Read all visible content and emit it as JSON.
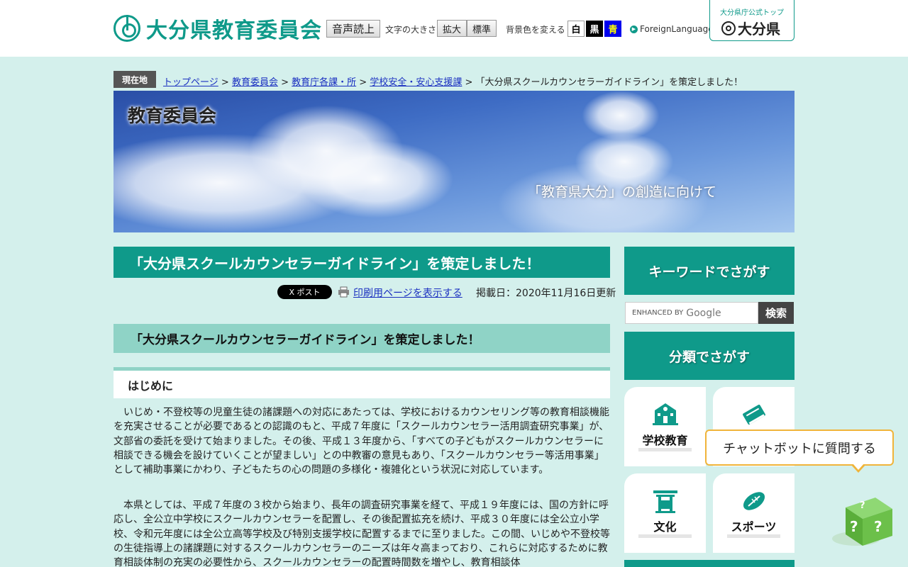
{
  "header": {
    "logo_text": "大分県教育委員会",
    "voice_button": "音声読上",
    "font_size_label": "文字の大きさ",
    "enlarge_button": "拡大",
    "standard_button": "標準",
    "bg_color_label": "背景色を変える",
    "bg_white": "白",
    "bg_black": "黒",
    "bg_blue": "青",
    "foreign_language": "ForeignLanguage",
    "pref_top_caption": "大分県庁公式トップ",
    "pref_top_name": "大分県"
  },
  "breadcrumb": {
    "tag": "現在地",
    "items": [
      {
        "label": "トップページ"
      },
      {
        "label": "教育委員会"
      },
      {
        "label": "教育庁各課・所"
      },
      {
        "label": "学校安全・安心支援課"
      }
    ],
    "current": "「大分県スクールカウンセラーガイドライン」を策定しました！",
    "separator": ">"
  },
  "banner": {
    "title": "教育委員会",
    "subtitle": "「教育県大分」の創造に向けて"
  },
  "main": {
    "page_title": "「大分県スクールカウンセラーガイドライン」を策定しました！",
    "x_post": "X ポスト",
    "print_link": "印刷用ページを表示する",
    "published": "掲載日：2020年11月16日更新",
    "h2": "「大分県スクールカウンセラーガイドライン」を策定しました！",
    "h3": "はじめに",
    "paragraphs": [
      "いじめ・不登校等の児童生徒の諸課題への対応にあたっては、学校におけるカウンセリング等の教育相談機能を充実させることが必要であるとの認識のもと、平成７年度に「スクールカウンセラー活用調査研究事業」が、文部省の委託を受けて始まりました。その後、平成１３年度から、「すべての子どもがスクールカウンセラーに相談できる機会を設けていくことが望ましい」との中教審の意見もあり、「スクールカウンセラー等活用事業」として補助事業にかわり、子どもたちの心の問題の多様化・複雑化という状況に対応しています。",
      "本県としては、平成７年度の３校から始まり、長年の調査研究事業を経て、平成１９年度には、国の方針に呼応し、全公立中学校にスクールカウンセラーを配置し、その後配置拡充を続け、平成３０年度には全公立小学校、令和元年度には全公立高等学校及び特別支援学校に配置するまでに至りました。この間、いじめや不登校等の生徒指導上の諸課題に対するスクールカウンセラーのニーズは年々高まっており、これらに対応するために教育相談体制の充実の必要性から、スクールカウンセラーの配置時間数を増やし、教育相談体"
    ]
  },
  "sidebar": {
    "keyword_heading": "キーワードでさがす",
    "search_enhanced": "ENHANCED BY",
    "search_google": "Google",
    "search_button": "検索",
    "category_heading": "分類でさがす",
    "categories": [
      {
        "label": "学校教育",
        "icon": "school-icon"
      },
      {
        "label": "",
        "icon": "book-icon"
      },
      {
        "label": "文化",
        "icon": "shrine-icon"
      },
      {
        "label": "スポーツ",
        "icon": "rugby-ball-icon"
      }
    ]
  },
  "chatbot": {
    "bubble": "チャットボットに質問する",
    "cube_text": "? ?"
  },
  "colors": {
    "brand": "#0f9a8a",
    "light_teal": "#8fd3c6",
    "page_bg": "#d4f0ec",
    "chat_border": "#f0b43a",
    "cube_green": "#6cc04a"
  }
}
